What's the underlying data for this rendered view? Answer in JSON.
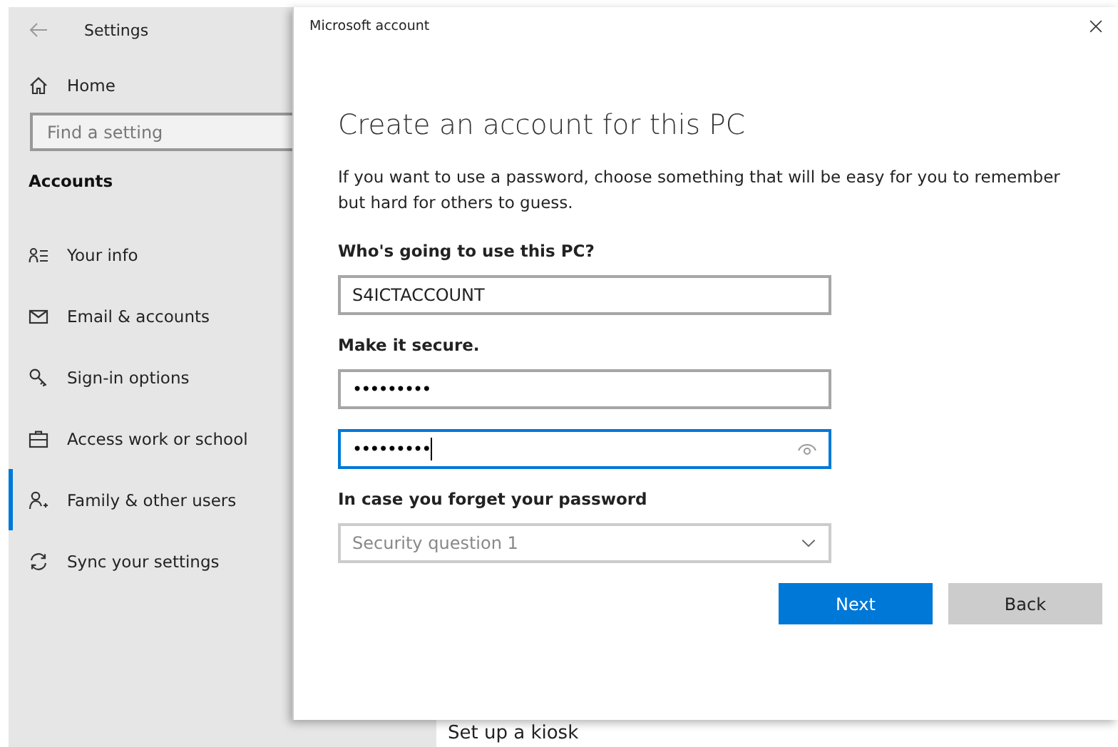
{
  "settings": {
    "title": "Settings",
    "home": "Home",
    "search": {
      "placeholder": "Find a setting"
    },
    "section": "Accounts",
    "items": [
      {
        "label": "Your info",
        "selected": false
      },
      {
        "label": "Email & accounts",
        "selected": false
      },
      {
        "label": "Sign-in options",
        "selected": false
      },
      {
        "label": "Access work or school",
        "selected": false
      },
      {
        "label": "Family & other users",
        "selected": true
      },
      {
        "label": "Sync your settings",
        "selected": false
      }
    ],
    "behind_text": "Set up a kiosk"
  },
  "dialog": {
    "title": "Microsoft account",
    "heading": "Create an account for this PC",
    "intro": "If you want to use a password, choose something that will be easy for you to remember but hard for others to guess.",
    "sections": [
      {
        "label": "Who's going to use this PC?",
        "fields": [
          {
            "kind": "text",
            "value": "S4ICTACCOUNT",
            "focused": false
          }
        ]
      },
      {
        "label": "Make it secure.",
        "fields": [
          {
            "kind": "password",
            "value": "•••••••••",
            "focused": false
          },
          {
            "kind": "password",
            "value": "•••••••••",
            "focused": true
          }
        ]
      },
      {
        "label": "In case you forget your password",
        "fields": [
          {
            "kind": "dropdown",
            "placeholder": "Security question 1",
            "focused": false
          }
        ]
      }
    ],
    "buttons": [
      {
        "label": "Next",
        "kind": "primary"
      },
      {
        "label": "Back",
        "kind": "secondary"
      }
    ]
  }
}
